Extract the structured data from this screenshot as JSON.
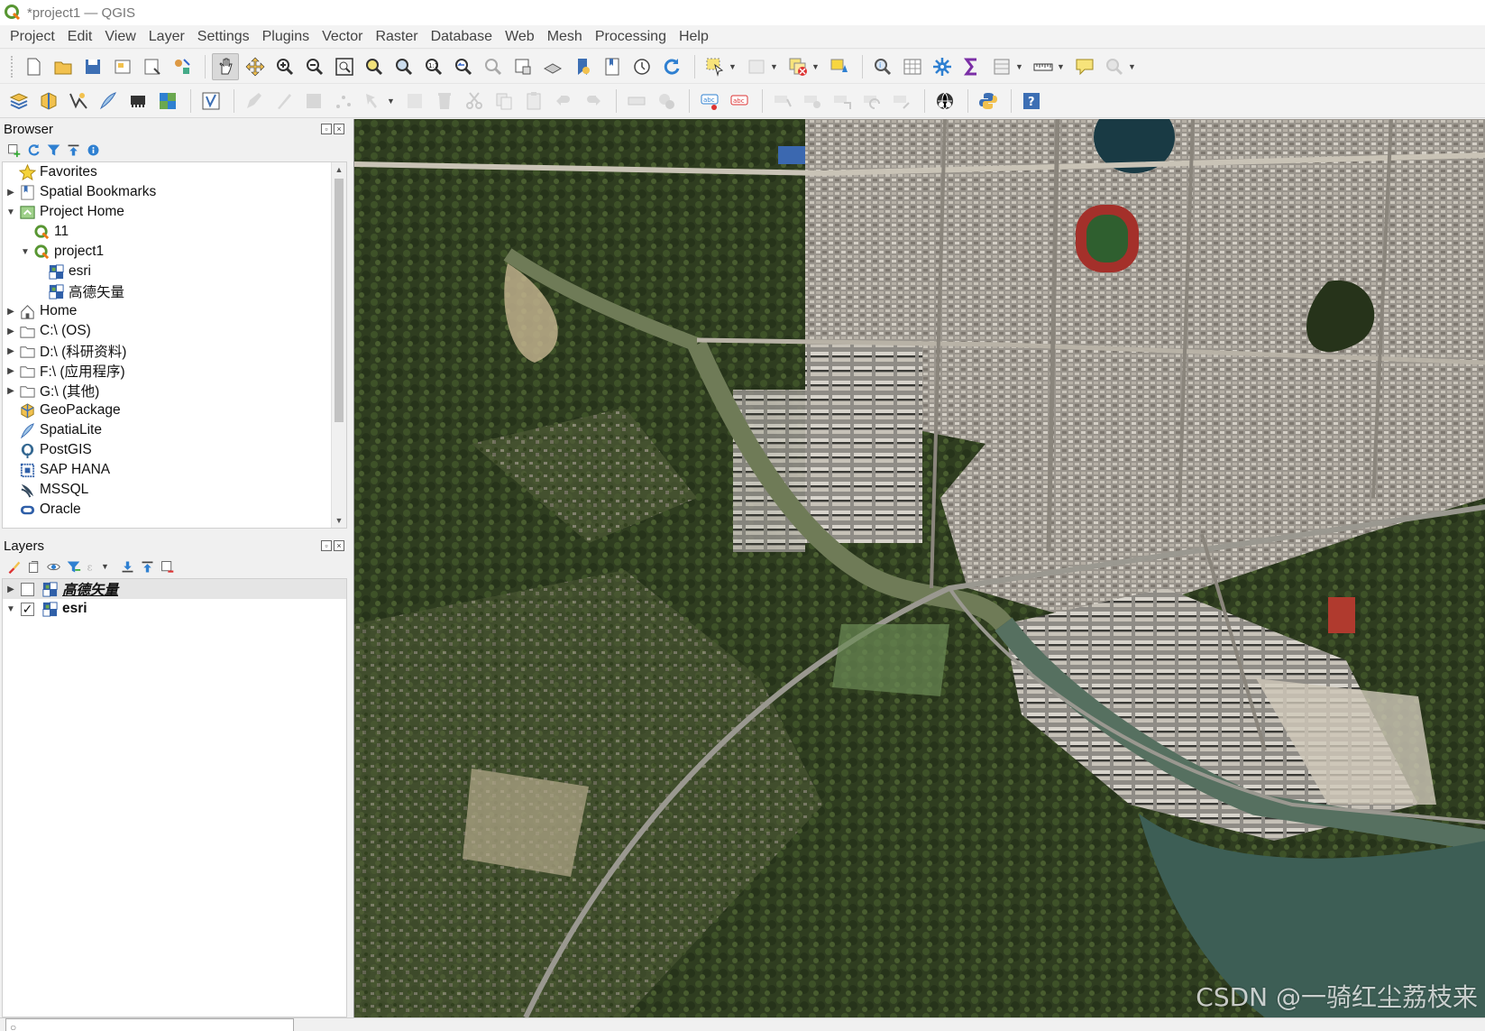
{
  "window": {
    "title": "*project1 — QGIS"
  },
  "menu": [
    "Project",
    "Edit",
    "View",
    "Layer",
    "Settings",
    "Plugins",
    "Vector",
    "Raster",
    "Database",
    "Web",
    "Mesh",
    "Processing",
    "Help"
  ],
  "browser": {
    "title": "Browser",
    "items": [
      {
        "label": "Favorites",
        "icon": "star-icon",
        "indent": 0,
        "arrow": ""
      },
      {
        "label": "Spatial Bookmarks",
        "icon": "bookmark-icon",
        "indent": 0,
        "arrow": "right"
      },
      {
        "label": "Project Home",
        "icon": "project-home-icon",
        "indent": 0,
        "arrow": "down"
      },
      {
        "label": "11",
        "icon": "qgis-project-icon",
        "indent": 1,
        "arrow": ""
      },
      {
        "label": "project1",
        "icon": "qgis-project-icon",
        "indent": 1,
        "arrow": "down"
      },
      {
        "label": "esri",
        "icon": "raster-layer-icon",
        "indent": 2,
        "arrow": ""
      },
      {
        "label": "高德矢量",
        "icon": "raster-layer-icon",
        "indent": 2,
        "arrow": ""
      },
      {
        "label": "Home",
        "icon": "home-icon",
        "indent": 0,
        "arrow": "right"
      },
      {
        "label": "C:\\ (OS)",
        "icon": "folder-icon",
        "indent": 0,
        "arrow": "right"
      },
      {
        "label": "D:\\ (科研资料)",
        "icon": "folder-icon",
        "indent": 0,
        "arrow": "right"
      },
      {
        "label": "F:\\ (应用程序)",
        "icon": "folder-icon",
        "indent": 0,
        "arrow": "right"
      },
      {
        "label": "G:\\ (其他)",
        "icon": "folder-icon",
        "indent": 0,
        "arrow": "right"
      },
      {
        "label": "GeoPackage",
        "icon": "geopackage-icon",
        "indent": 0,
        "arrow": ""
      },
      {
        "label": "SpatiaLite",
        "icon": "spatialite-icon",
        "indent": 0,
        "arrow": ""
      },
      {
        "label": "PostGIS",
        "icon": "postgis-icon",
        "indent": 0,
        "arrow": ""
      },
      {
        "label": "SAP HANA",
        "icon": "sap-hana-icon",
        "indent": 0,
        "arrow": ""
      },
      {
        "label": "MSSQL",
        "icon": "mssql-icon",
        "indent": 0,
        "arrow": ""
      },
      {
        "label": "Oracle",
        "icon": "oracle-icon",
        "indent": 0,
        "arrow": ""
      }
    ]
  },
  "layers": {
    "title": "Layers",
    "items": [
      {
        "label": "高德矢量",
        "checked": false,
        "selected": true
      },
      {
        "label": "esri",
        "checked": true,
        "selected": false
      }
    ]
  },
  "map": {
    "watermark": "CSDN @一骑红尘荔枝来"
  }
}
